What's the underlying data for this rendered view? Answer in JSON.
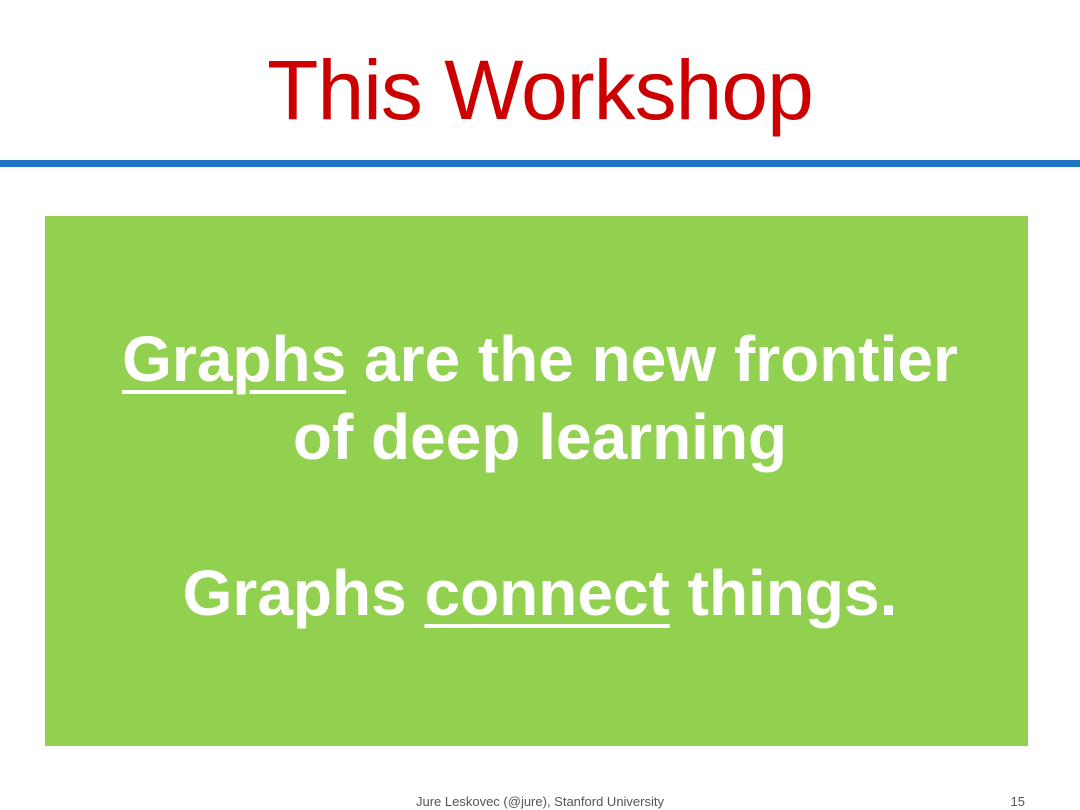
{
  "slide": {
    "title": "This Workshop",
    "statement_1": {
      "underlined": "Graphs",
      "rest": " are the new frontier",
      "line2": "of deep learning"
    },
    "statement_2": {
      "before": "Graphs ",
      "underlined": "connect",
      "after": " things."
    },
    "footer": "Jure Leskovec (@jure), Stanford University",
    "page_number": "15"
  },
  "colors": {
    "title": "#cc0000",
    "rule": "#1f77c4",
    "panel": "#92d050",
    "text": "#ffffff"
  }
}
